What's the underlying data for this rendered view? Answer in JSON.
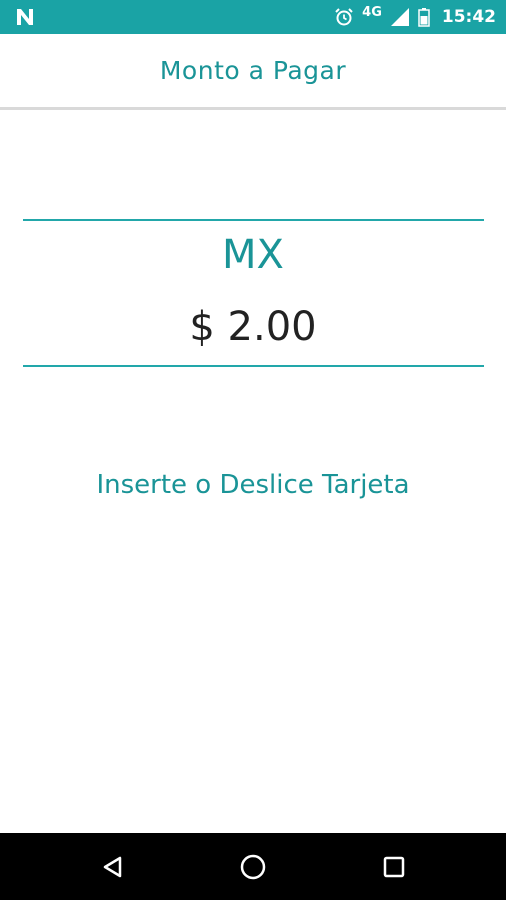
{
  "status_bar": {
    "network": "4G",
    "time": "15:42",
    "icons": [
      "notification-n-icon",
      "alarm-icon",
      "signal-icon",
      "battery-icon"
    ]
  },
  "header": {
    "title": "Monto a Pagar"
  },
  "payment": {
    "currency": "MX",
    "amount": "$ 2.00",
    "instruction": "Inserte o Deslice Tarjeta"
  },
  "nav_bar": {
    "buttons": [
      "back-icon",
      "home-icon",
      "recents-icon"
    ]
  },
  "colors": {
    "accent": "#1aa3a5",
    "text_accent": "#1a9497",
    "amount_text": "#222222"
  }
}
